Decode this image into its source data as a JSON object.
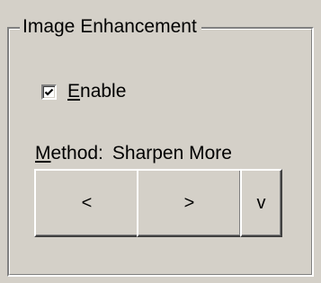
{
  "group": {
    "title": "Image Enhancement"
  },
  "enable": {
    "label_mnemonic": "E",
    "label_rest": "nable",
    "checked": true
  },
  "method": {
    "label_mnemonic": "M",
    "label_rest": "ethod:",
    "value": "Sharpen More"
  },
  "buttons": {
    "prev_label": "<",
    "next_label": ">",
    "dropdown_label": "v"
  },
  "colors": {
    "face": "#d4d0c8",
    "highlight": "#ffffff",
    "shadow": "#808080",
    "dark_shadow": "#404040",
    "text": "#000000"
  }
}
